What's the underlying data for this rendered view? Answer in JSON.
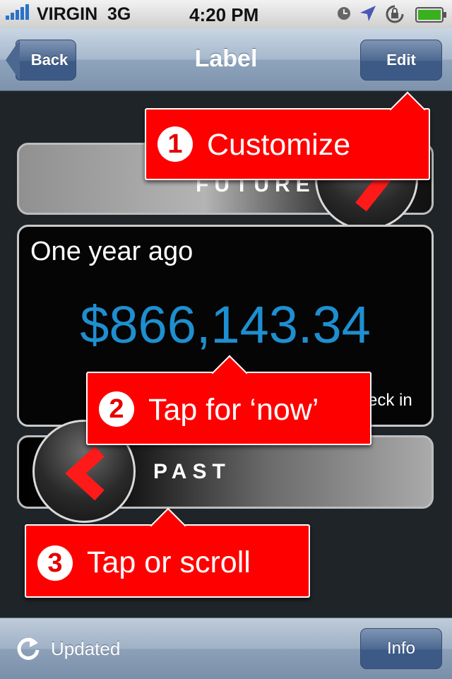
{
  "status_bar": {
    "carrier": "VIRGIN",
    "network": "3G",
    "time": "4:20 PM"
  },
  "nav": {
    "back_label": "Back",
    "title": "Label",
    "edit_label": "Edit"
  },
  "future": {
    "label": "FUTURE"
  },
  "main": {
    "period": "One year ago",
    "amount": "$866,143.34",
    "footer_fragment": "eck in"
  },
  "past": {
    "label": "PAST"
  },
  "callouts": [
    {
      "number": "1",
      "text": "Customize"
    },
    {
      "number": "2",
      "text": "Tap for ‘now’"
    },
    {
      "number": "3",
      "text": "Tap or scroll"
    }
  ],
  "toolbar": {
    "updated_label": "Updated",
    "info_label": "Info"
  },
  "colors": {
    "amount": "#1e8fd0",
    "callout": "#ff0000",
    "nav_button": "#3d5a86"
  }
}
